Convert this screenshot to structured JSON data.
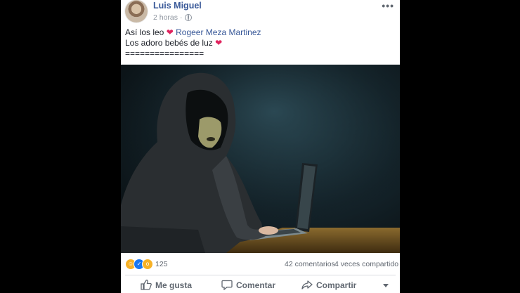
{
  "post": {
    "author": "Luis Miguel",
    "time": "2 horas",
    "line1_text": "Así los leo",
    "line1_mention": "Rogeer Meza Martinez",
    "line2_text": "Los adoro bebés de luz",
    "line3_text": "================",
    "heart": "❤"
  },
  "stats": {
    "reaction_count": "125",
    "comments": "42 comentarios",
    "shares": "4 veces compartido"
  },
  "actions": {
    "like": "Me gusta",
    "comment": "Comentar",
    "share": "Compartir"
  },
  "icons": {
    "reactions": [
      "haha-icon",
      "like-icon",
      "wow-icon"
    ],
    "privacy": "globe-icon",
    "menu": "more-options-icon"
  },
  "colors": {
    "link": "#385898",
    "heart": "#e0245e",
    "muted": "#606770"
  }
}
